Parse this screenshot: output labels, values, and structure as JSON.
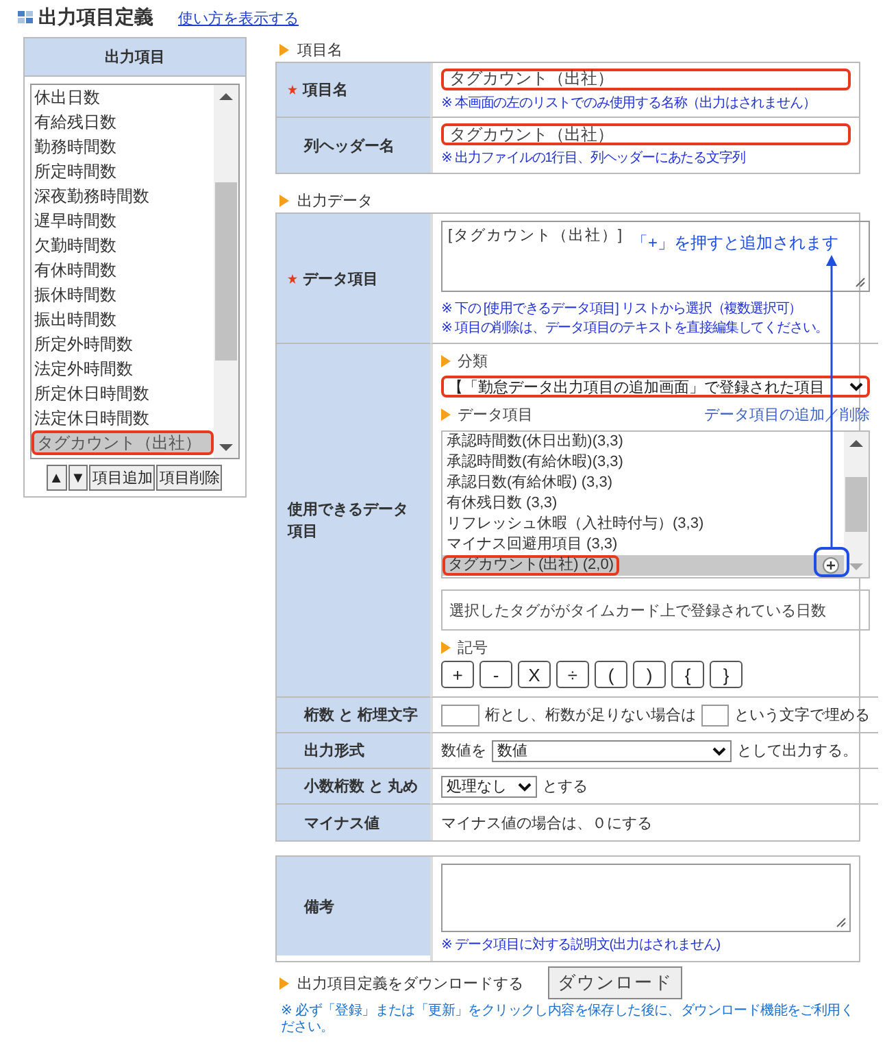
{
  "header": {
    "title": "出力項目定義",
    "help_link": "使い方を表示する"
  },
  "sidebar": {
    "heading": "出力項目",
    "items": [
      {
        "label": "休出日数",
        "selected": false
      },
      {
        "label": "有給残日数",
        "selected": false
      },
      {
        "label": "勤務時間数",
        "selected": false
      },
      {
        "label": "所定時間数",
        "selected": false
      },
      {
        "label": "深夜勤務時間数",
        "selected": false
      },
      {
        "label": "遅早時間数",
        "selected": false
      },
      {
        "label": "欠勤時間数",
        "selected": false
      },
      {
        "label": "有休時間数",
        "selected": false
      },
      {
        "label": "振休時間数",
        "selected": false
      },
      {
        "label": "振出時間数",
        "selected": false
      },
      {
        "label": "所定外時間数",
        "selected": false
      },
      {
        "label": "法定外時間数",
        "selected": false
      },
      {
        "label": "所定休日時間数",
        "selected": false
      },
      {
        "label": "法定休日時間数",
        "selected": false
      },
      {
        "label": "タグカウント（出社）",
        "selected": true
      }
    ],
    "buttons": [
      "▲",
      "▼",
      "項目追加",
      "項目削除"
    ]
  },
  "item_name_section": {
    "title": "項目名",
    "rows": [
      {
        "label": "項目名",
        "required": true,
        "value": "タグカウント（出社）",
        "highlighted": true,
        "note": "※ 本画面の左のリストでのみ使用する名称（出力はされません）"
      },
      {
        "label": "列ヘッダー名",
        "required": false,
        "value": "タグカウント（出社）",
        "highlighted": true,
        "note": "※ 出力ファイルの1行目、列ヘッダーにあたる文字列"
      }
    ]
  },
  "output_data_section": {
    "title": "出力データ",
    "data_item": {
      "label": "データ項目",
      "required": true,
      "value": "[タグカウント（出社）]",
      "notes": [
        "※ 下の [使用できるデータ項目] リストから選択（複数選択可）",
        "※ 項目の削除は、データ項目のテキストを直接編集してください。"
      ]
    },
    "available": {
      "label": "使用できるデータ項目",
      "category_title": "分類",
      "category_value": "【「勤怠データ出力項目の追加画面」で登録された項目",
      "category_highlighted": true,
      "list_title": "データ項目",
      "list_link": "データ項目の追加／削除",
      "items": [
        {
          "label": "承認時間数(休日出勤)(3,3)",
          "selected": false
        },
        {
          "label": "承認時間数(有給休暇)(3,3)",
          "selected": false
        },
        {
          "label": "承認日数(有給休暇) (3,3)",
          "selected": false
        },
        {
          "label": "有休残日数 (3,3)",
          "selected": false
        },
        {
          "label": "リフレッシュ休暇（入社時付与）(3,3)",
          "selected": false
        },
        {
          "label": "マイナス回避用項目 (3,3)",
          "selected": false
        },
        {
          "label": "タグカウント(出社) (2,0)",
          "selected": true
        }
      ],
      "description": "選択したタグががタイムカード上で登録されている日数",
      "symbols_title": "記号",
      "symbols": [
        "+",
        "-",
        "X",
        "÷",
        "(",
        ")",
        "{",
        "}"
      ]
    },
    "digits": {
      "label": "桁数 と 桁埋文字",
      "text_1": "桁とし、桁数が足りない場合は",
      "text_2": "という文字で埋める"
    },
    "format": {
      "label": "出力形式",
      "prefix": "数値を",
      "value": "数値",
      "suffix": "として出力する。"
    },
    "decimal": {
      "label": "小数桁数 と 丸め",
      "value": "処理なし",
      "suffix": "とする"
    },
    "minus": {
      "label": "マイナス値",
      "text": "マイナス値の場合は、０にする"
    }
  },
  "remarks": {
    "label": "備考",
    "note": "※ データ項目に対する説明文(出力はされません)"
  },
  "download": {
    "label": "出力項目定義をダウンロードする",
    "button": "ダウンロード",
    "note": "※ 必ず「登録」または「更新」をクリックし内容を保存した後に、ダウンロード機能をご利用ください。"
  },
  "annotation": {
    "text": "「+」を押すと追加されます"
  }
}
